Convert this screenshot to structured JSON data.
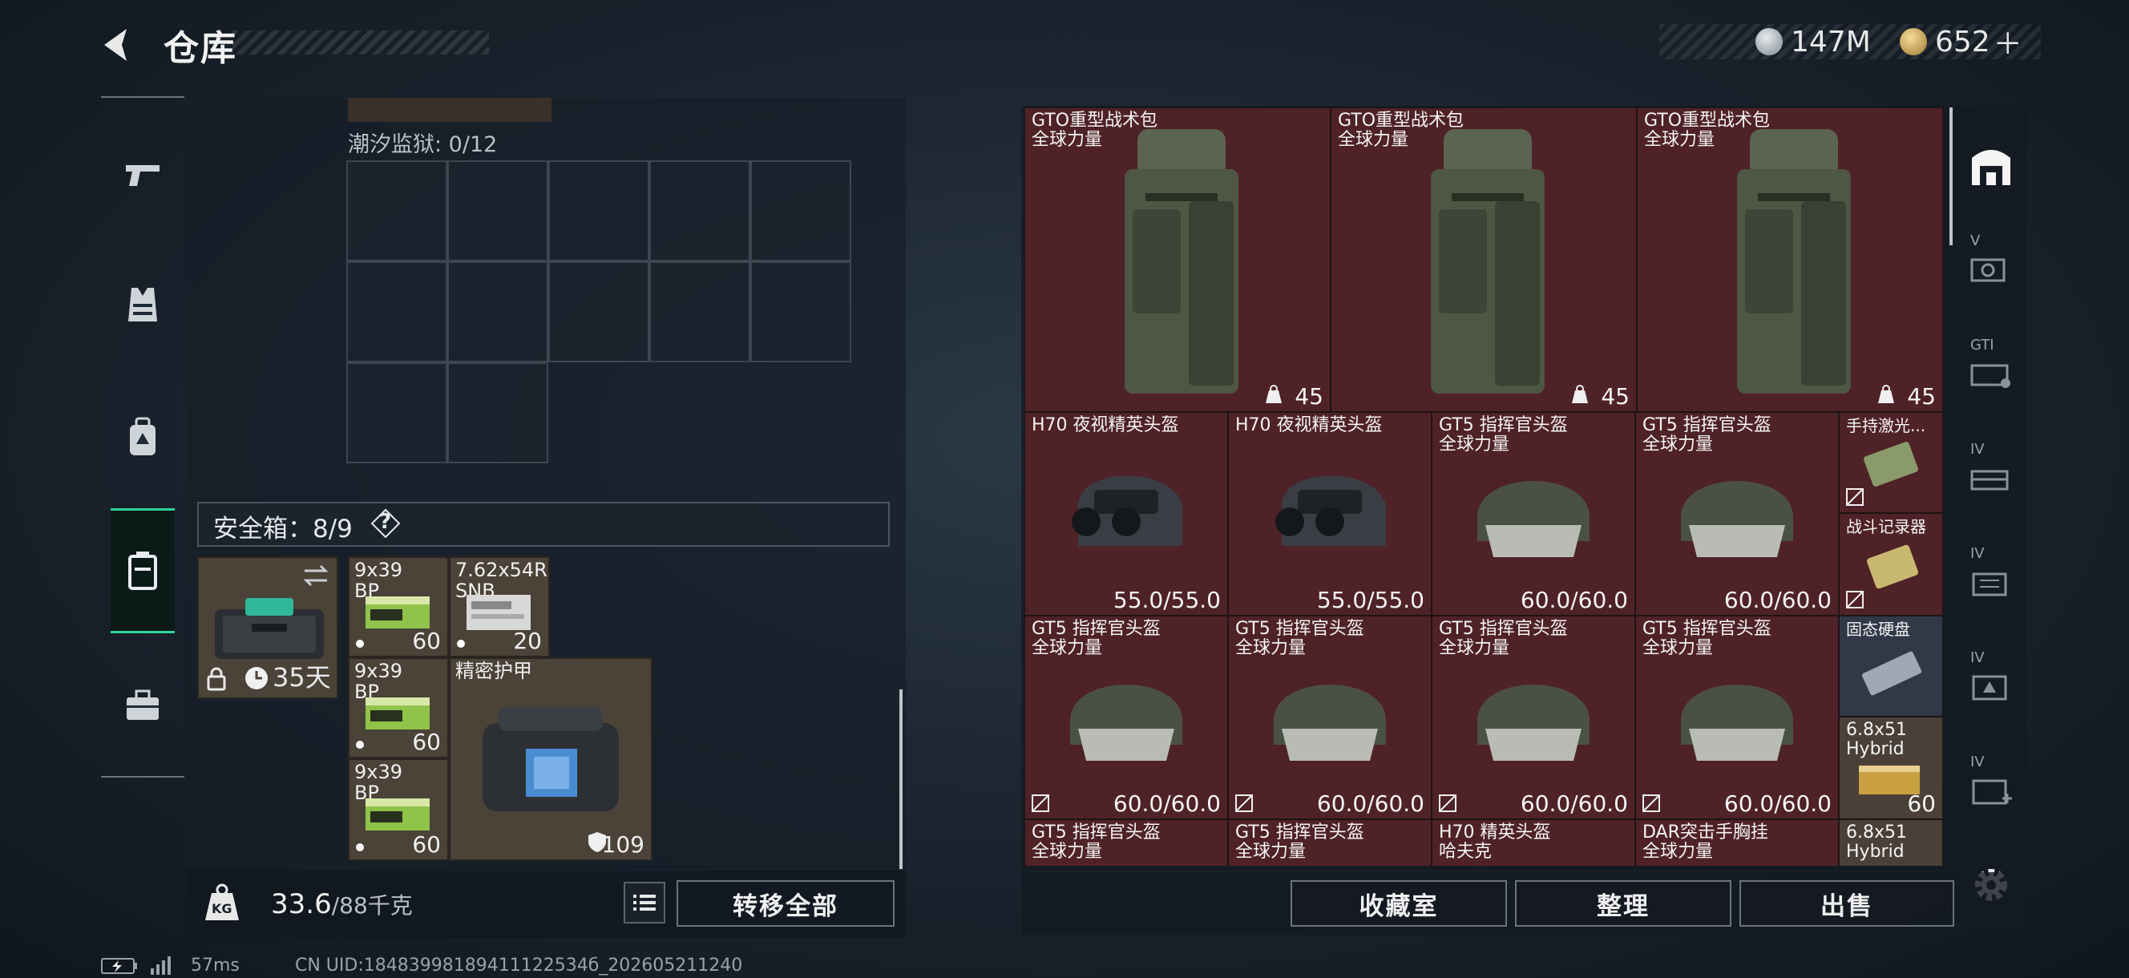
{
  "header": {
    "title": "仓库",
    "currency": [
      {
        "icon": "silver-coin-icon",
        "value": "147M",
        "color": "#c8ccd0"
      },
      {
        "icon": "gold-coin-icon",
        "value": "652",
        "suffix": "＋",
        "color": "#d8b060"
      }
    ]
  },
  "left_nav": [
    "weapon-icon",
    "armor-vest-icon",
    "backpack-icon",
    "safebox-icon",
    "toolbox-icon"
  ],
  "storage": {
    "prison_label": "潮汐监狱: 0/12",
    "safebox_label": "安全箱：8/9",
    "safebox_help": "?",
    "case": {
      "days": "35天"
    },
    "items": [
      {
        "name": "9x39\nBP",
        "count": "60"
      },
      {
        "name": "7.62x54R\nSNB",
        "count": "20"
      },
      {
        "name": "9x39\nBP",
        "count": "60"
      },
      {
        "name": "精密护甲",
        "count": "109"
      },
      {
        "name": "9x39\nBP",
        "count": "60"
      }
    ],
    "weight": {
      "value": "33.6",
      "max": "/88千克"
    },
    "weight_icon_text": "KG",
    "transfer_all": "转移全部"
  },
  "inventory": {
    "row1": [
      {
        "name": "GTO重型战术包",
        "sub": "全球力量",
        "value": "45"
      },
      {
        "name": "GTO重型战术包",
        "sub": "全球力量",
        "value": "45"
      },
      {
        "name": "GTO重型战术包",
        "sub": "全球力量",
        "value": "45"
      }
    ],
    "row2": [
      {
        "name": "H70 夜视精英头盔",
        "sub": "",
        "value": "55.0/55.0"
      },
      {
        "name": "H70 夜视精英头盔",
        "sub": "",
        "value": "55.0/55.0"
      },
      {
        "name": "GT5 指挥官头盔",
        "sub": "全球力量",
        "value": "60.0/60.0"
      },
      {
        "name": "GT5 指挥官头盔",
        "sub": "全球力量",
        "value": "60.0/60.0"
      }
    ],
    "row3": [
      {
        "name": "GT5 指挥官头盔",
        "sub": "全球力量",
        "value": "60.0/60.0"
      },
      {
        "name": "GT5 指挥官头盔",
        "sub": "全球力量",
        "value": "60.0/60.0"
      },
      {
        "name": "GT5 指挥官头盔",
        "sub": "全球力量",
        "value": "60.0/60.0"
      },
      {
        "name": "GT5 指挥官头盔",
        "sub": "全球力量",
        "value": "60.0/60.0"
      }
    ],
    "row4": [
      {
        "name": "GT5 指挥官头盔",
        "sub": "全球力量"
      },
      {
        "name": "GT5 指挥官头盔",
        "sub": "全球力量"
      },
      {
        "name": "H70 精英头盔",
        "sub": "哈夫克"
      },
      {
        "name": "DAR突击手胸挂",
        "sub": "全球力量"
      }
    ],
    "side": [
      {
        "name": "手持激光...",
        "value": ""
      },
      {
        "name": "战斗记录器",
        "value": ""
      },
      {
        "name": "固态硬盘",
        "value": ""
      },
      {
        "name": "6.8x51\nHybrid",
        "value": "60"
      },
      {
        "name": "6.8x51\nHybrid",
        "value": ""
      }
    ]
  },
  "right_nav": {
    "tags": [
      "V",
      "GTI",
      "IV",
      "IV",
      "IV",
      "IV"
    ]
  },
  "bottom_buttons": {
    "collection": "收藏室",
    "sort": "整理",
    "sell": "出售"
  },
  "status_bar": {
    "ping": "57ms",
    "uid": "CN UID:18483998189411122534б_202605211240"
  }
}
